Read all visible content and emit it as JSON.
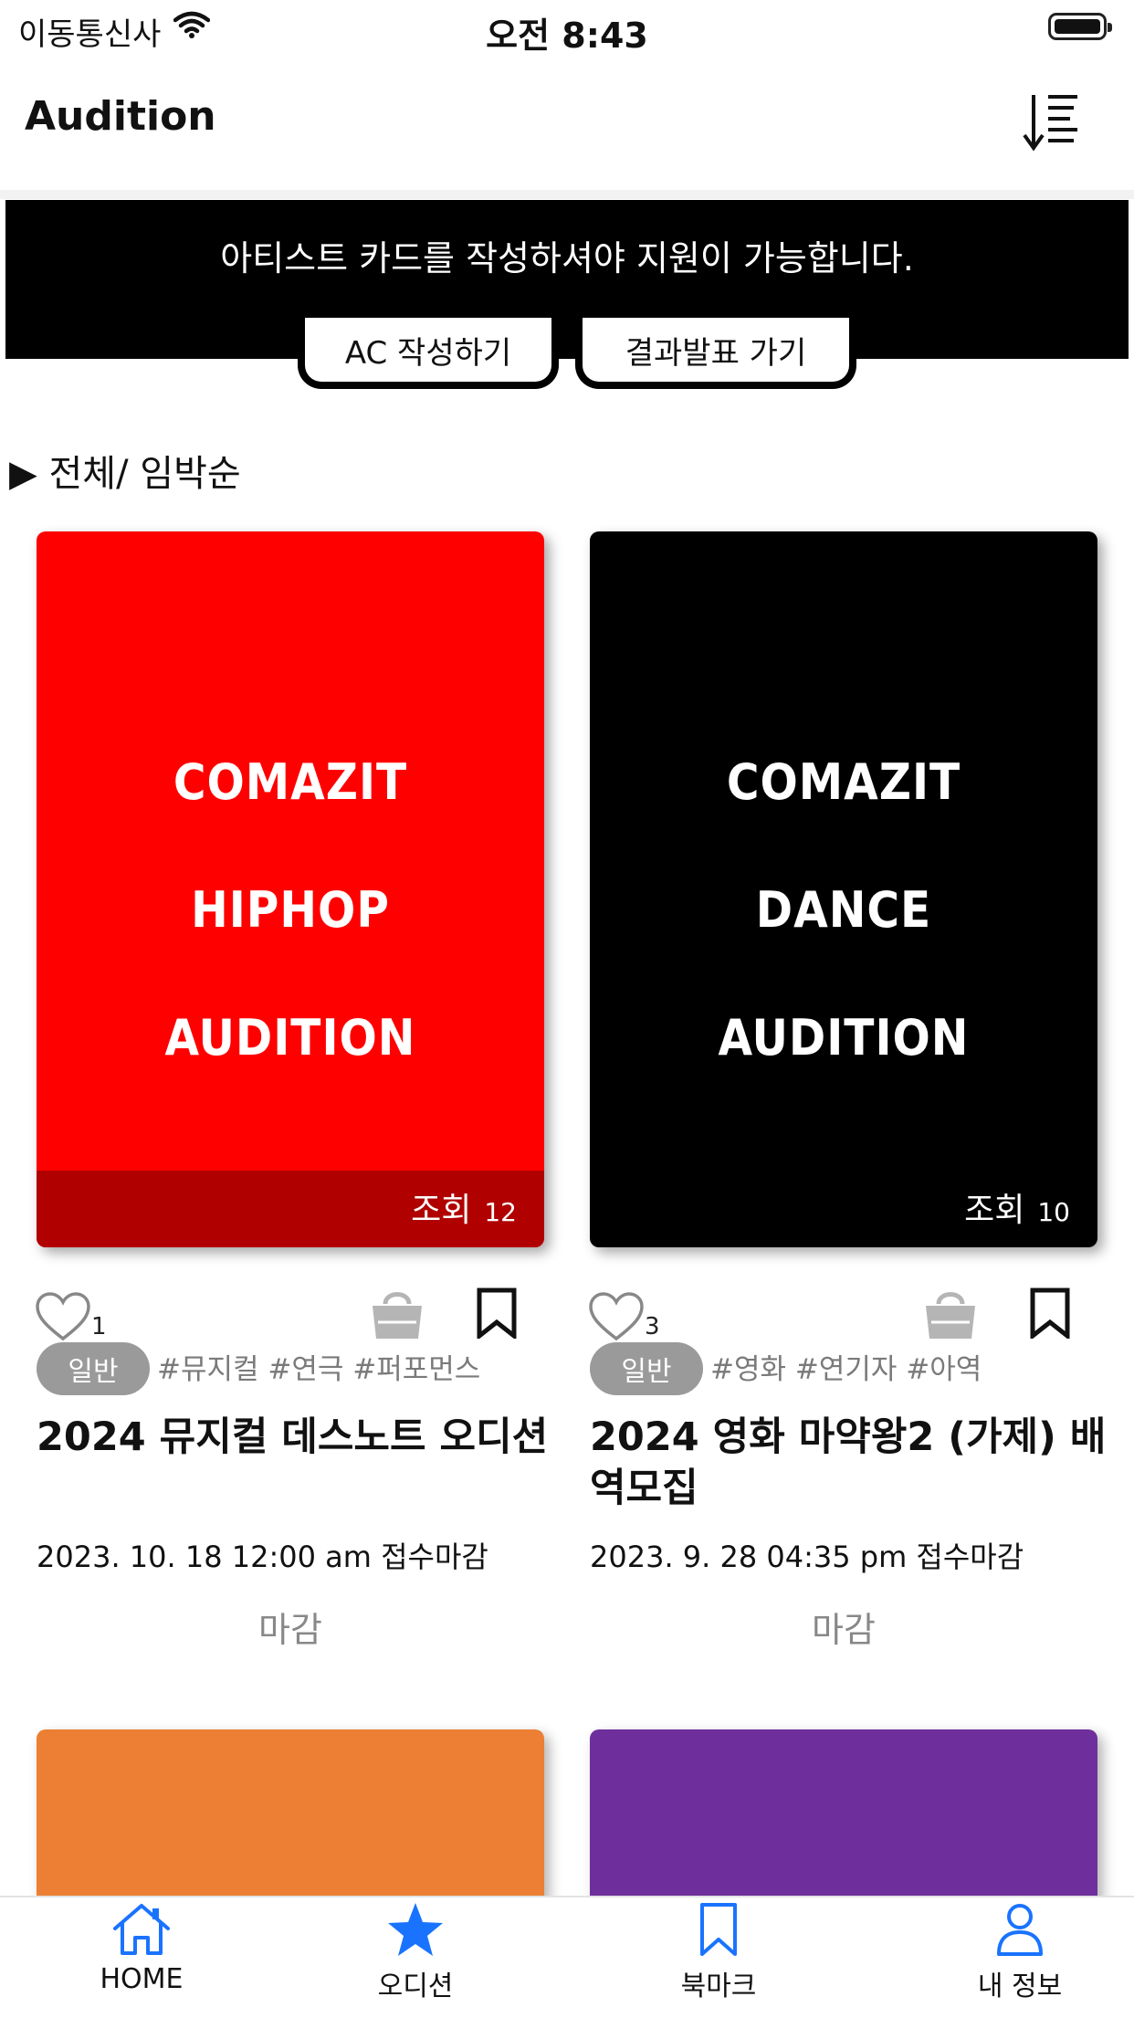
{
  "status_bar": {
    "carrier": "이동통신사",
    "time": "오전 8:43"
  },
  "header": {
    "title": "Audition",
    "sort_icon": "sort-descending-icon"
  },
  "banner": {
    "message": "아티스트 카드를 작성하셔야 지원이 가능합니다.",
    "ac_button": "AC 작성하기",
    "result_button": "결과발표 가기"
  },
  "filter": {
    "label": "▶ 전체/ 임박순"
  },
  "cards": [
    {
      "poster_lines": [
        "COMAZIT",
        "HIPHOP",
        "AUDITION"
      ],
      "poster_color": "#ff0000",
      "views_label": "조회",
      "views": "12",
      "likes": "1",
      "category": "일반",
      "tags": "#뮤지컬 #연극 #퍼포먼스",
      "title": "2024 뮤지컬 데스노트 오디션",
      "deadline": "2023. 10. 18 12:00 am 접수마감",
      "status": "마감"
    },
    {
      "poster_lines": [
        "COMAZIT",
        "DANCE",
        "AUDITION"
      ],
      "poster_color": "#000000",
      "views_label": "조회",
      "views": "10",
      "likes": "3",
      "category": "일반",
      "tags": "#영화 #연기자 #아역",
      "title": "2024 영화 마약왕2 (가제) 배역모집",
      "deadline": "2023. 9. 28 04:35 pm 접수마감",
      "status": "마감"
    }
  ],
  "next_cards": [
    {
      "poster_color": "#ec7f33"
    },
    {
      "poster_color": "#6e2f9c"
    }
  ],
  "tab_bar": {
    "tabs": [
      {
        "label": "HOME",
        "icon": "home-icon",
        "active": true
      },
      {
        "label": "오디션",
        "icon": "star-icon",
        "active": true
      },
      {
        "label": "북마크",
        "icon": "bookmark-icon",
        "active": false
      },
      {
        "label": "내 정보",
        "icon": "person-icon",
        "active": false
      }
    ],
    "accent": "#1a73ff"
  }
}
